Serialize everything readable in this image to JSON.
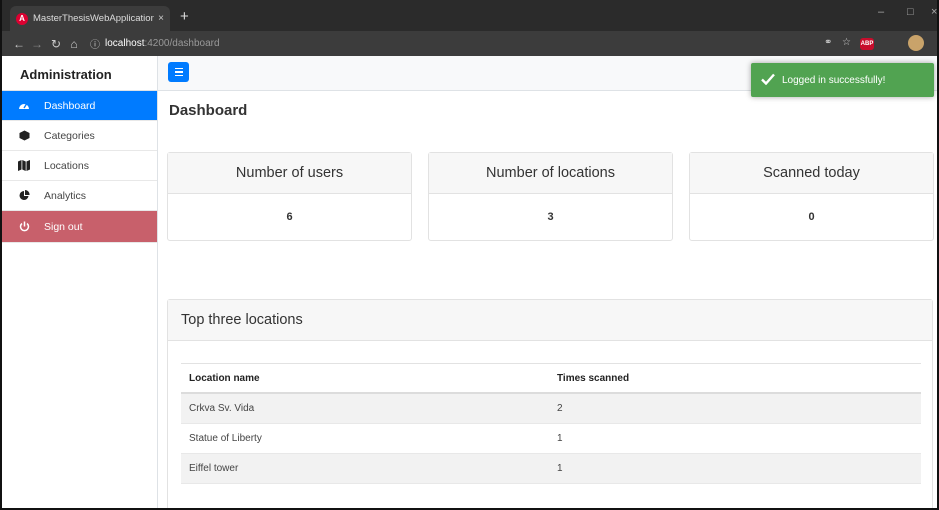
{
  "browser": {
    "tab_title": "MasterThesisWebApplicationFron",
    "tab_close": "×",
    "new_tab": "+",
    "url_host": "localhost",
    "url_path": ":4200/dashboard",
    "adblock_label": "ABP"
  },
  "sidebar": {
    "brand": "Administration",
    "items": [
      {
        "label": "Dashboard",
        "icon": "tachometer-icon"
      },
      {
        "label": "Categories",
        "icon": "cube-icon"
      },
      {
        "label": "Locations",
        "icon": "map-icon"
      },
      {
        "label": "Analytics",
        "icon": "pie-chart-icon"
      },
      {
        "label": "Sign out",
        "icon": "power-icon"
      }
    ]
  },
  "main": {
    "title": "Dashboard",
    "cards": [
      {
        "title": "Number of users",
        "value": "6"
      },
      {
        "title": "Number of locations",
        "value": "3"
      },
      {
        "title": "Scanned today",
        "value": "0"
      }
    ],
    "top_locations": {
      "title": "Top three locations",
      "columns": [
        "Location name",
        "Times scanned"
      ],
      "rows": [
        {
          "name": "Crkva Sv. Vida",
          "count": "2"
        },
        {
          "name": "Statue of Liberty",
          "count": "1"
        },
        {
          "name": "Eiffel tower",
          "count": "1"
        }
      ]
    }
  },
  "toast": {
    "message": "Logged in successfully!"
  },
  "colors": {
    "primary": "#007bff",
    "danger_muted": "#c8606b",
    "success": "#51a351"
  }
}
